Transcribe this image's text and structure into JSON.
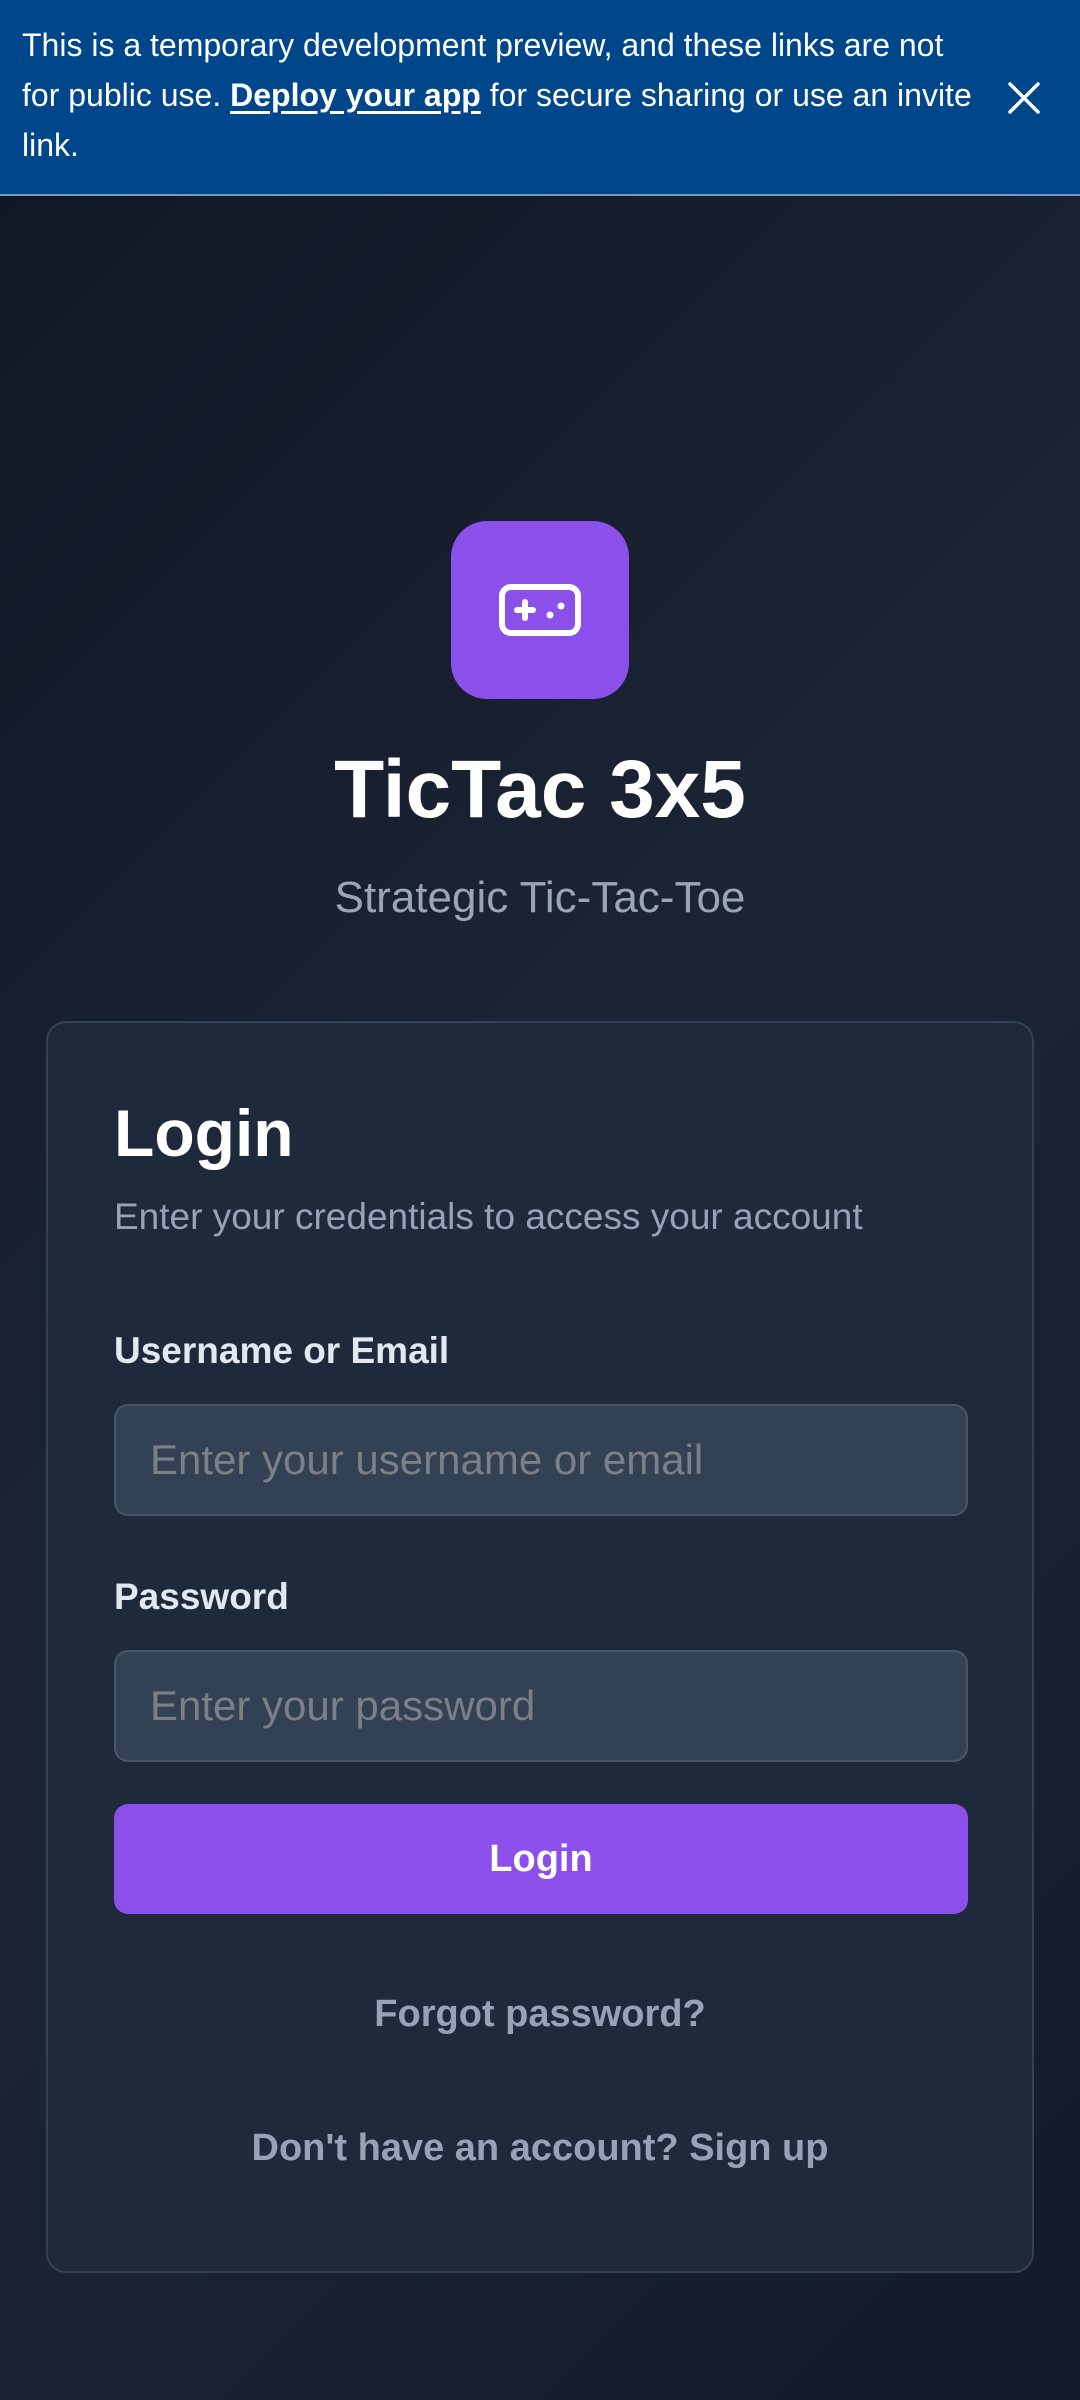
{
  "banner": {
    "text_before": "This is a temporary development preview, and these links are not for public use. ",
    "link_text": "Deploy your app",
    "text_after": " for secure sharing or use an invite link."
  },
  "app": {
    "logo_icon": "gamepad-icon",
    "title": "TicTac 3x5",
    "subtitle": "Strategic Tic-Tac-Toe",
    "accent_color": "#8b4fea"
  },
  "login_card": {
    "title": "Login",
    "description": "Enter your credentials to access your account",
    "username": {
      "label": "Username or Email",
      "placeholder": "Enter your username or email",
      "value": ""
    },
    "password": {
      "label": "Password",
      "placeholder": "Enter your password",
      "value": ""
    },
    "submit_label": "Login",
    "forgot_password": "Forgot password?",
    "signup_prompt": "Don't have an account? Sign up"
  }
}
